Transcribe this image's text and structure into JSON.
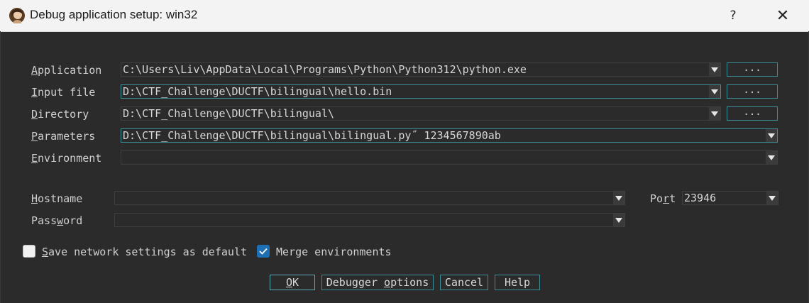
{
  "window": {
    "title": "Debug application setup: win32",
    "help_label": "?",
    "close_label": "✕"
  },
  "fields": {
    "application": {
      "label_u": "A",
      "label_rest": "pplication",
      "value": "C:\\Users\\Liv\\AppData\\Local\\Programs\\Python\\Python312\\python.exe"
    },
    "input_file": {
      "label_u": "I",
      "label_rest": "nput file",
      "value": "D:\\CTF_Challenge\\DUCTF\\bilingual\\hello.bin"
    },
    "directory": {
      "label_u": "D",
      "label_rest": "irectory",
      "value": "D:\\CTF_Challenge\\DUCTF\\bilingual\\"
    },
    "parameters": {
      "label_u": "P",
      "label_rest": "arameters",
      "value": "D:\\CTF_Challenge\\DUCTF\\bilingual\\bilingual.py˝ 1234567890ab"
    },
    "environment": {
      "label_u": "E",
      "label_rest": "nvironment",
      "value": ""
    },
    "hostname": {
      "label_u": "H",
      "label_rest": "ostname",
      "value": ""
    },
    "password": {
      "label_pre": "Pass",
      "label_u": "w",
      "label_rest": "ord",
      "value": ""
    },
    "port": {
      "label_pre": "Po",
      "label_u": "r",
      "label_rest": "t",
      "value": "23946"
    }
  },
  "browse_label": "...",
  "checkboxes": {
    "save_network": {
      "label_u": "S",
      "label_rest": "ave network settings as default",
      "checked": false
    },
    "merge_env": {
      "label": "Merge environments",
      "checked": true
    }
  },
  "buttons": {
    "ok": {
      "label_u": "O",
      "label_rest": "K"
    },
    "debugger_options": {
      "label_pre": "Debugger ",
      "label_u": "o",
      "label_rest": "ptions"
    },
    "cancel": "Cancel",
    "help": "Help"
  },
  "colors": {
    "accent": "#3b8f97",
    "checkbox_on": "#1f6fb5",
    "background": "#2b2b2b"
  }
}
